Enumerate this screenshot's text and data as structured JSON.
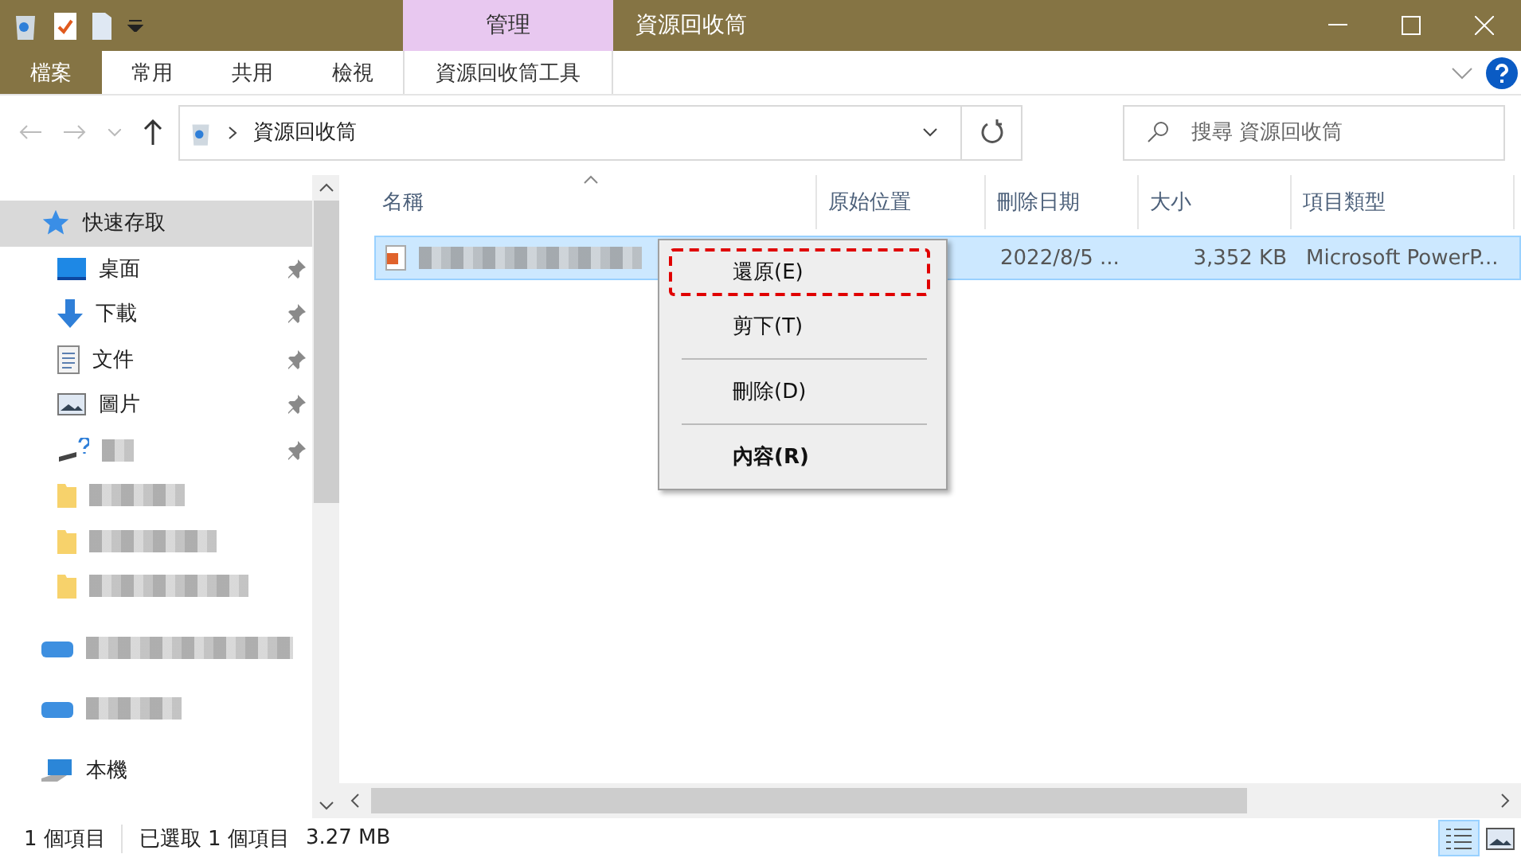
{
  "window": {
    "title": "資源回收筒",
    "context_tab": "管理"
  },
  "ribbon_tabs": [
    {
      "label": "檔案",
      "kind": "file"
    },
    {
      "label": "常用",
      "kind": "tab"
    },
    {
      "label": "共用",
      "kind": "tab"
    },
    {
      "label": "檢視",
      "kind": "tab"
    },
    {
      "label": "資源回收筒工具",
      "kind": "context"
    }
  ],
  "address": {
    "path": "資源回收筒"
  },
  "search": {
    "placeholder": "搜尋 資源回收筒"
  },
  "sidebar": {
    "items": [
      {
        "kind": "quick-access",
        "label": "快速存取",
        "selected": true
      },
      {
        "kind": "desktop",
        "label": "桌面",
        "pinned": true,
        "selected": false
      },
      {
        "kind": "downloads",
        "label": "下載",
        "pinned": true,
        "selected": false
      },
      {
        "kind": "documents",
        "label": "文件",
        "pinned": true,
        "selected": false
      },
      {
        "kind": "pictures",
        "label": "圖片",
        "pinned": true,
        "selected": false
      },
      {
        "kind": "drive",
        "pinned": true,
        "selected": false
      },
      {
        "kind": "folder",
        "pinned": false,
        "selected": false
      },
      {
        "kind": "folder",
        "pinned": false,
        "selected": false
      },
      {
        "kind": "folder",
        "pinned": false,
        "selected": false
      },
      {
        "kind": "cloud",
        "selected": false
      },
      {
        "kind": "cloud",
        "selected": false
      },
      {
        "kind": "computer",
        "label": "本機",
        "selected": false
      }
    ]
  },
  "table": {
    "columns": [
      "名稱",
      "原始位置",
      "刪除日期",
      "大小",
      "項目類型"
    ],
    "rows": [
      {
        "selected": true,
        "date": "2022/8/5 ...",
        "size": "3,352 KB",
        "type": "Microsoft PowerP..."
      }
    ]
  },
  "context_menu": {
    "items": [
      {
        "kind": "item",
        "label": "還原(E)",
        "bold": false,
        "highlighted": true
      },
      {
        "kind": "item",
        "label": "剪下(T)",
        "bold": false,
        "highlighted": false
      },
      {
        "kind": "separator"
      },
      {
        "kind": "item",
        "label": "刪除(D)",
        "bold": false,
        "highlighted": false
      },
      {
        "kind": "separator"
      },
      {
        "kind": "item",
        "label": "內容(R)",
        "bold": true,
        "highlighted": false
      }
    ]
  },
  "status_bar": {
    "items": [
      "1 個項目",
      "已選取 1 個項目",
      "3.27 MB"
    ],
    "views": [
      {
        "kind": "details",
        "selected": true
      },
      {
        "kind": "large-icons",
        "selected": false
      }
    ]
  }
}
